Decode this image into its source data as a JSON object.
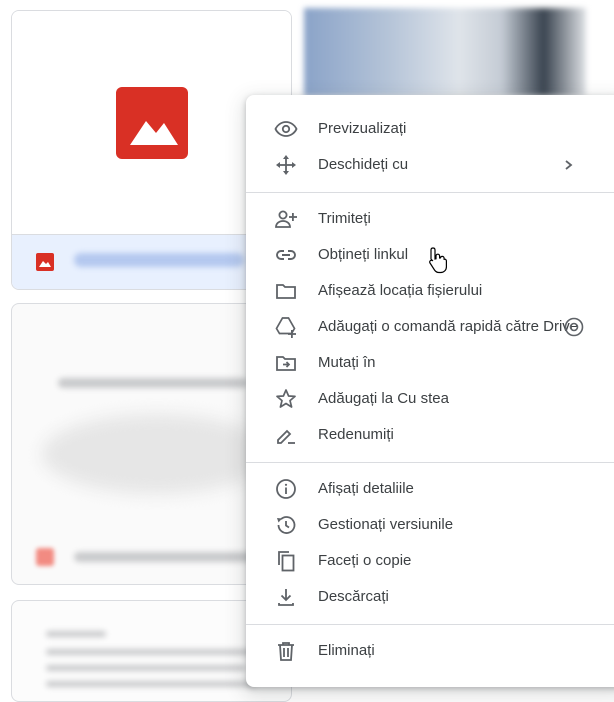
{
  "menu": {
    "items": [
      {
        "label": "Previzualizați",
        "icon": "eye-icon"
      },
      {
        "label": "Deschideți cu",
        "icon": "open-with-icon",
        "submenu": true
      },
      {
        "label": "Trimiteți",
        "icon": "person-add-icon"
      },
      {
        "label": "Obțineți linkul",
        "icon": "link-icon"
      },
      {
        "label": "Afișează locația fișierului",
        "icon": "folder-icon"
      },
      {
        "label": "Adăugați o comandă rapidă către Drive",
        "icon": "drive-add-icon"
      },
      {
        "label": "Mutați în",
        "icon": "move-to-folder-icon"
      },
      {
        "label": "Adăugați la Cu stea",
        "icon": "star-icon"
      },
      {
        "label": "Redenumiți",
        "icon": "rename-pencil-icon"
      },
      {
        "label": "Afișați detaliile",
        "icon": "info-icon"
      },
      {
        "label": "Gestionați versiunile",
        "icon": "history-icon"
      },
      {
        "label": "Faceți o copie",
        "icon": "copy-icon"
      },
      {
        "label": "Descărcați",
        "icon": "download-icon"
      },
      {
        "label": "Eliminați",
        "icon": "trash-icon"
      }
    ]
  },
  "colors": {
    "icon": "#5f6368",
    "text": "#3c4043",
    "image_file_red": "#d93025",
    "selected_bg": "#e8f0fe"
  }
}
